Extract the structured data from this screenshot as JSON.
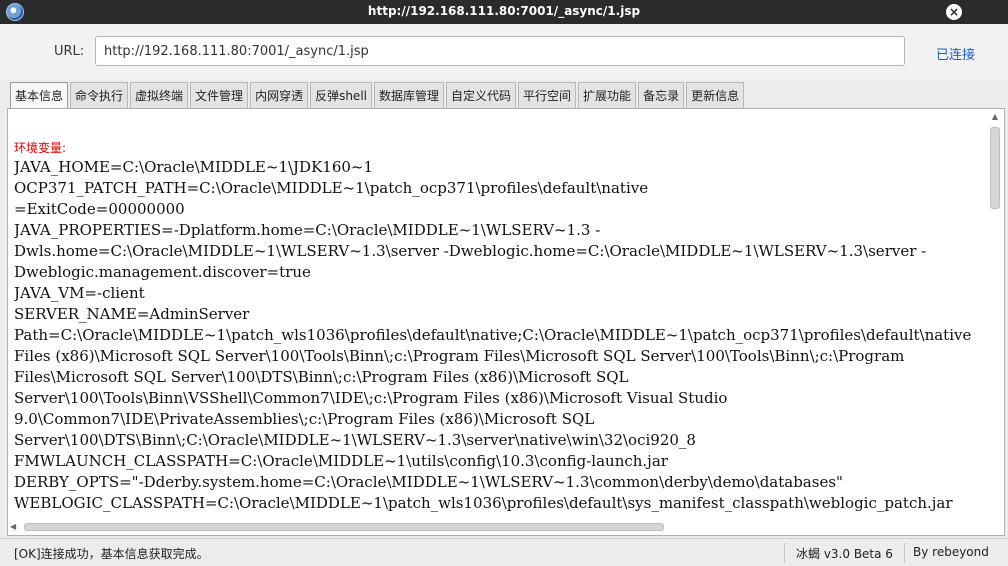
{
  "window": {
    "title": "http://192.168.111.80:7001/_async/1.jsp"
  },
  "url_bar": {
    "label": "URL:",
    "value": "http://192.168.111.80:7001/_async/1.jsp",
    "status": "已连接"
  },
  "tabs": [
    "基本信息",
    "命令执行",
    "虚拟终端",
    "文件管理",
    "内网穿透",
    "反弹shell",
    "数据库管理",
    "自定义代码",
    "平行空间",
    "扩展功能",
    "备忘录",
    "更新信息"
  ],
  "active_tab": "基本信息",
  "content": {
    "section_label": "环境变量:",
    "lines": [
      "JAVA_HOME=C:\\Oracle\\MIDDLE~1\\JDK160~1",
      "OCP371_PATCH_PATH=C:\\Oracle\\MIDDLE~1\\patch_ocp371\\profiles\\default\\native",
      "=ExitCode=00000000",
      "JAVA_PROPERTIES=-Dplatform.home=C:\\Oracle\\MIDDLE~1\\WLSERV~1.3 -",
      "Dwls.home=C:\\Oracle\\MIDDLE~1\\WLSERV~1.3\\server -Dweblogic.home=C:\\Oracle\\MIDDLE~1\\WLSERV~1.3\\server -",
      "Dweblogic.management.discover=true",
      "JAVA_VM=-client",
      "SERVER_NAME=AdminServer",
      "Path=C:\\Oracle\\MIDDLE~1\\patch_wls1036\\profiles\\default\\native;C:\\Oracle\\MIDDLE~1\\patch_ocp371\\profiles\\default\\native",
      "Files (x86)\\Microsoft SQL Server\\100\\Tools\\Binn\\;c:\\Program Files\\Microsoft SQL Server\\100\\Tools\\Binn\\;c:\\Program",
      "Files\\Microsoft SQL Server\\100\\DTS\\Binn\\;c:\\Program Files (x86)\\Microsoft SQL",
      "Server\\100\\Tools\\Binn\\VSShell\\Common7\\IDE\\;c:\\Program Files (x86)\\Microsoft Visual Studio",
      "9.0\\Common7\\IDE\\PrivateAssemblies\\;c:\\Program Files (x86)\\Microsoft SQL",
      "Server\\100\\DTS\\Binn\\;C:\\Oracle\\MIDDLE~1\\WLSERV~1.3\\server\\native\\win\\32\\oci920_8",
      "FMWLAUNCH_CLASSPATH=C:\\Oracle\\MIDDLE~1\\utils\\config\\10.3\\config-launch.jar",
      "DERBY_OPTS=\"-Dderby.system.home=C:\\Oracle\\MIDDLE~1\\WLSERV~1.3\\common\\derby\\demo\\databases\"",
      "WEBLOGIC_CLASSPATH=C:\\Oracle\\MIDDLE~1\\patch_wls1036\\profiles\\default\\sys_manifest_classpath\\weblogic_patch.jar"
    ]
  },
  "status_bar": {
    "message": "[OK]连接成功，基本信息获取完成。",
    "version": "冰蝎 v3.0 Beta 6",
    "author": "By rebeyond"
  }
}
